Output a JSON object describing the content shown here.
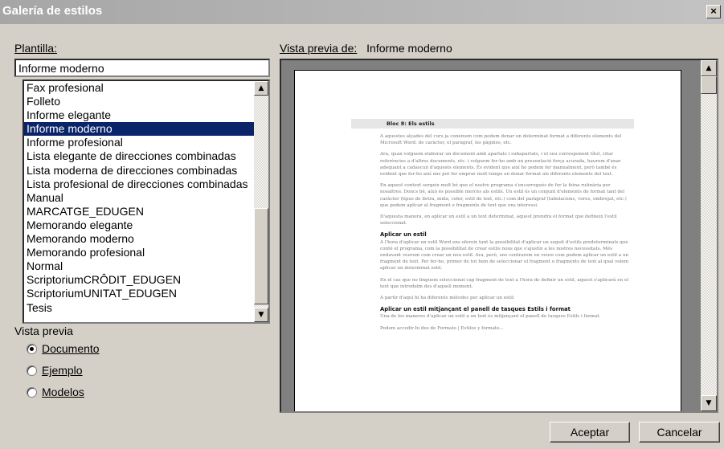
{
  "window": {
    "title": "Galería de estilos",
    "close": "×"
  },
  "template": {
    "label": "Plantilla:",
    "value": "Informe moderno",
    "items": [
      "Fax profesional",
      "Folleto",
      "Informe elegante",
      "Informe moderno",
      "Informe profesional",
      "Lista elegante de direcciones combinadas",
      "Lista moderna de direcciones combinadas",
      "Lista profesional de direcciones combinadas",
      "Manual",
      "MARCATGE_EDUGEN",
      "Memorando elegante",
      "Memorando moderno",
      "Memorando profesional",
      "Normal",
      "ScriptoriumCRÔDIT_EDUGEN",
      "ScriptoriumUNITAT_EDUGEN",
      "Tesis"
    ],
    "selected_index": 3
  },
  "preview_mode": {
    "label": "Vista previa",
    "options": [
      {
        "label": "Documento",
        "checked": true
      },
      {
        "label": "Ejemplo",
        "checked": false
      },
      {
        "label": "Modelos",
        "checked": false
      }
    ]
  },
  "preview": {
    "label": "Vista previa de:",
    "name": "Informe moderno",
    "doc": {
      "heading": "Bloc 8: Els estils",
      "p1": "A aquestes alçades del curs ja coneixem com podem donar un determinat format a diferents elements del Microsoft Word: de caràcter, el paràgraf, les pàgines, etc.",
      "p2": "Ara, quan volguem elaborar un document amb apartats i subapartats, i el seu corresponent títol, citar referències a d'altres documents, etc. i volguem fer-ho amb un presentació força acurada, haurem d'anar adequant a cadascun d'aquests elements. És evident que així ho podem fer manualment, però també és evident que fer-ho així ens pot fer emprar molt temps en donar format als diferents elements del text.",
      "p3": "En aquest context sorgeix molt bé que el nostre programa s'encarregués de fer la feina rutinària per nosaltres. Doncs bé, això és possible mercès als estils. Un estil és un conjunt d'elements de format tant del caràcter (tipus de lletra, mida, color, estil de text, etc.) com del paràgraf (tabulacions, vores, ombrejat, etc.) que podem aplicar al fragment o fragments de text que ens interessi.",
      "p4": "D'aquesta manera, en aplicar un estil a un text determinat, aquest prendrà el format que defineix l'estil seleccionat.",
      "h2": "Aplicar un estil",
      "p5": "A l'hora d'aplicar un estil Word ens ofereix tant la possibilitat d'aplicar un seguit d'estils predeterminats que conté el programa, com la possibilitat de crear estils nous que s'ajustin a les nostres necessitats. Més endavant veurem com crear un nou estil. Ara, però, ens centrarem en veure com podem aplicar un estil a un fragment de text. Per fer-ho, primer de tot hem de seleccionar el fragment o fragments de text al qual volem aplicar un determinat estil.",
      "p6": "En el cas que no tinguem seleccionat cap fragment de text a l'hora de definir un estil, aquest s'aplicarà en el text que introduïm des d'aquell moment.",
      "p7": "A partir d'aquí hi ha diferents mètodes per aplicar un estil:",
      "h3": "Aplicar un estil mitjançant el panell de tasques Estils i format",
      "p8": "Una de les maneres d'aplicar un estil a un text és mitjançant el panell de tasques Estils i format.",
      "p9": "Podem accedir-hi des de Formato | Estilos y formato..."
    }
  },
  "buttons": {
    "ok": "Aceptar",
    "cancel": "Cancelar"
  }
}
